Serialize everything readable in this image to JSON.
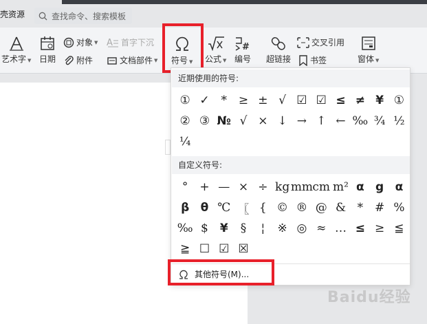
{
  "topbar": {
    "partial_label": "壳资源",
    "search_placeholder": "查找命令、搜索模板"
  },
  "ribbon": {
    "art_text": "艺术字",
    "date": "日期",
    "object": "对象",
    "attachment": "附件",
    "drop_cap": "首字下沉",
    "doc_parts": "文档部件",
    "symbol": "符号",
    "formula": "公式",
    "numbering": "编号",
    "cross_ref": "交叉引用",
    "hyperlink": "超链接",
    "bookmark": "书签",
    "window": "窗体"
  },
  "symbol_menu": {
    "recent_heading": "近期使用的符号:",
    "recent_symbols": [
      "①",
      "✓",
      "*",
      "≥",
      "±",
      "√",
      "☑",
      "☑",
      "≤",
      "≠",
      "¥",
      "①",
      "②",
      "③",
      "№",
      "√",
      "×",
      "↓",
      "→",
      "↑",
      "←",
      "‰",
      "¾",
      "½",
      "¼"
    ],
    "custom_heading": "自定义符号:",
    "custom_symbols": [
      "°",
      "+",
      "—",
      "×",
      "÷",
      "kg",
      "mm",
      "cm",
      "m²",
      "α",
      "g",
      "α",
      "β",
      "θ",
      "℃",
      "〖",
      "{",
      "©",
      "®",
      "@",
      "&",
      "*",
      "#",
      "%",
      "‰",
      "$",
      "¥",
      "§",
      "¦",
      "※",
      "◎",
      "≈",
      "…",
      "≤",
      "≥",
      "≦",
      "≧",
      "☐",
      "☑",
      "☒"
    ],
    "more_symbols": "其他符号(M)..."
  },
  "watermark": "Baidu经验",
  "colors": {
    "highlight": "#e8202a",
    "ribbon_bg": "#f3f4f6",
    "section_bg": "#f2f3f5"
  }
}
